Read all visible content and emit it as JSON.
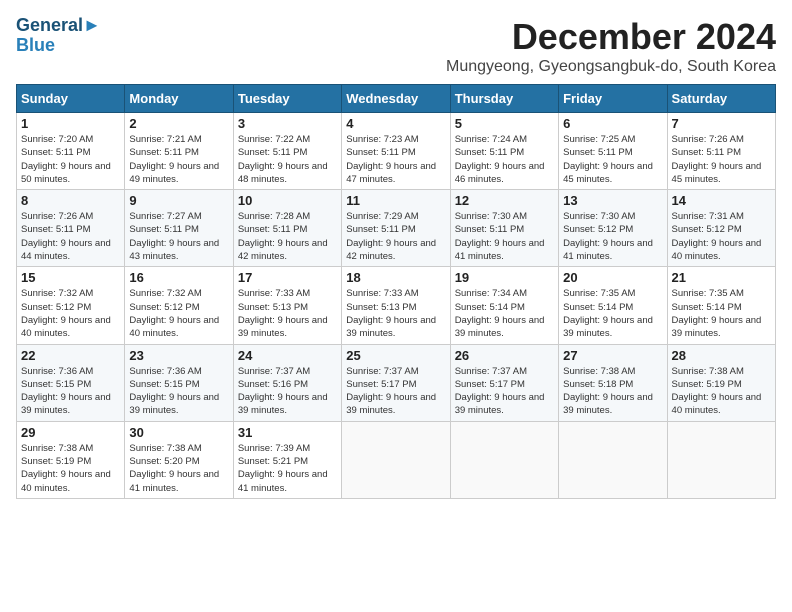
{
  "logo": {
    "line1": "General",
    "line2": "Blue",
    "symbol": "▶"
  },
  "header": {
    "month": "December 2024",
    "location": "Mungyeong, Gyeongsangbuk-do, South Korea"
  },
  "days_of_week": [
    "Sunday",
    "Monday",
    "Tuesday",
    "Wednesday",
    "Thursday",
    "Friday",
    "Saturday"
  ],
  "weeks": [
    [
      {
        "day": "1",
        "sunrise": "Sunrise: 7:20 AM",
        "sunset": "Sunset: 5:11 PM",
        "daylight": "Daylight: 9 hours and 50 minutes."
      },
      {
        "day": "2",
        "sunrise": "Sunrise: 7:21 AM",
        "sunset": "Sunset: 5:11 PM",
        "daylight": "Daylight: 9 hours and 49 minutes."
      },
      {
        "day": "3",
        "sunrise": "Sunrise: 7:22 AM",
        "sunset": "Sunset: 5:11 PM",
        "daylight": "Daylight: 9 hours and 48 minutes."
      },
      {
        "day": "4",
        "sunrise": "Sunrise: 7:23 AM",
        "sunset": "Sunset: 5:11 PM",
        "daylight": "Daylight: 9 hours and 47 minutes."
      },
      {
        "day": "5",
        "sunrise": "Sunrise: 7:24 AM",
        "sunset": "Sunset: 5:11 PM",
        "daylight": "Daylight: 9 hours and 46 minutes."
      },
      {
        "day": "6",
        "sunrise": "Sunrise: 7:25 AM",
        "sunset": "Sunset: 5:11 PM",
        "daylight": "Daylight: 9 hours and 45 minutes."
      },
      {
        "day": "7",
        "sunrise": "Sunrise: 7:26 AM",
        "sunset": "Sunset: 5:11 PM",
        "daylight": "Daylight: 9 hours and 45 minutes."
      }
    ],
    [
      {
        "day": "8",
        "sunrise": "Sunrise: 7:26 AM",
        "sunset": "Sunset: 5:11 PM",
        "daylight": "Daylight: 9 hours and 44 minutes."
      },
      {
        "day": "9",
        "sunrise": "Sunrise: 7:27 AM",
        "sunset": "Sunset: 5:11 PM",
        "daylight": "Daylight: 9 hours and 43 minutes."
      },
      {
        "day": "10",
        "sunrise": "Sunrise: 7:28 AM",
        "sunset": "Sunset: 5:11 PM",
        "daylight": "Daylight: 9 hours and 42 minutes."
      },
      {
        "day": "11",
        "sunrise": "Sunrise: 7:29 AM",
        "sunset": "Sunset: 5:11 PM",
        "daylight": "Daylight: 9 hours and 42 minutes."
      },
      {
        "day": "12",
        "sunrise": "Sunrise: 7:30 AM",
        "sunset": "Sunset: 5:11 PM",
        "daylight": "Daylight: 9 hours and 41 minutes."
      },
      {
        "day": "13",
        "sunrise": "Sunrise: 7:30 AM",
        "sunset": "Sunset: 5:12 PM",
        "daylight": "Daylight: 9 hours and 41 minutes."
      },
      {
        "day": "14",
        "sunrise": "Sunrise: 7:31 AM",
        "sunset": "Sunset: 5:12 PM",
        "daylight": "Daylight: 9 hours and 40 minutes."
      }
    ],
    [
      {
        "day": "15",
        "sunrise": "Sunrise: 7:32 AM",
        "sunset": "Sunset: 5:12 PM",
        "daylight": "Daylight: 9 hours and 40 minutes."
      },
      {
        "day": "16",
        "sunrise": "Sunrise: 7:32 AM",
        "sunset": "Sunset: 5:12 PM",
        "daylight": "Daylight: 9 hours and 40 minutes."
      },
      {
        "day": "17",
        "sunrise": "Sunrise: 7:33 AM",
        "sunset": "Sunset: 5:13 PM",
        "daylight": "Daylight: 9 hours and 39 minutes."
      },
      {
        "day": "18",
        "sunrise": "Sunrise: 7:33 AM",
        "sunset": "Sunset: 5:13 PM",
        "daylight": "Daylight: 9 hours and 39 minutes."
      },
      {
        "day": "19",
        "sunrise": "Sunrise: 7:34 AM",
        "sunset": "Sunset: 5:14 PM",
        "daylight": "Daylight: 9 hours and 39 minutes."
      },
      {
        "day": "20",
        "sunrise": "Sunrise: 7:35 AM",
        "sunset": "Sunset: 5:14 PM",
        "daylight": "Daylight: 9 hours and 39 minutes."
      },
      {
        "day": "21",
        "sunrise": "Sunrise: 7:35 AM",
        "sunset": "Sunset: 5:14 PM",
        "daylight": "Daylight: 9 hours and 39 minutes."
      }
    ],
    [
      {
        "day": "22",
        "sunrise": "Sunrise: 7:36 AM",
        "sunset": "Sunset: 5:15 PM",
        "daylight": "Daylight: 9 hours and 39 minutes."
      },
      {
        "day": "23",
        "sunrise": "Sunrise: 7:36 AM",
        "sunset": "Sunset: 5:15 PM",
        "daylight": "Daylight: 9 hours and 39 minutes."
      },
      {
        "day": "24",
        "sunrise": "Sunrise: 7:37 AM",
        "sunset": "Sunset: 5:16 PM",
        "daylight": "Daylight: 9 hours and 39 minutes."
      },
      {
        "day": "25",
        "sunrise": "Sunrise: 7:37 AM",
        "sunset": "Sunset: 5:17 PM",
        "daylight": "Daylight: 9 hours and 39 minutes."
      },
      {
        "day": "26",
        "sunrise": "Sunrise: 7:37 AM",
        "sunset": "Sunset: 5:17 PM",
        "daylight": "Daylight: 9 hours and 39 minutes."
      },
      {
        "day": "27",
        "sunrise": "Sunrise: 7:38 AM",
        "sunset": "Sunset: 5:18 PM",
        "daylight": "Daylight: 9 hours and 39 minutes."
      },
      {
        "day": "28",
        "sunrise": "Sunrise: 7:38 AM",
        "sunset": "Sunset: 5:19 PM",
        "daylight": "Daylight: 9 hours and 40 minutes."
      }
    ],
    [
      {
        "day": "29",
        "sunrise": "Sunrise: 7:38 AM",
        "sunset": "Sunset: 5:19 PM",
        "daylight": "Daylight: 9 hours and 40 minutes."
      },
      {
        "day": "30",
        "sunrise": "Sunrise: 7:38 AM",
        "sunset": "Sunset: 5:20 PM",
        "daylight": "Daylight: 9 hours and 41 minutes."
      },
      {
        "day": "31",
        "sunrise": "Sunrise: 7:39 AM",
        "sunset": "Sunset: 5:21 PM",
        "daylight": "Daylight: 9 hours and 41 minutes."
      },
      null,
      null,
      null,
      null
    ]
  ]
}
